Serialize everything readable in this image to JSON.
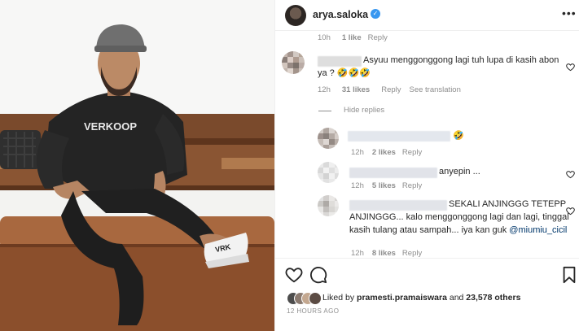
{
  "post": {
    "username": "arya.saloka",
    "verified_icon": "verified-badge-icon",
    "more_icon": "more-options-icon",
    "shirt_text": "VERKOOP",
    "sandal_text": "VRK"
  },
  "comments": [
    {
      "id": "c0",
      "age": "10h",
      "likes": "1 like",
      "reply": "Reply"
    },
    {
      "id": "c1",
      "text": "Asyuu menggonggong lagi tuh lupa di kasih abon ya ? 🤣🤣🤣",
      "age": "12h",
      "likes": "31 likes",
      "reply": "Reply",
      "translation": "See translation",
      "hide_replies": "Hide replies"
    }
  ],
  "replies": [
    {
      "id": "r1",
      "text": "🤣",
      "age": "12h",
      "likes": "2 likes",
      "reply": "Reply"
    },
    {
      "id": "r2",
      "text": "anyepin ...",
      "age": "12h",
      "likes": "5 likes",
      "reply": "Reply"
    },
    {
      "id": "r3",
      "line1": "SEKALI ANJINGGG TETEPP",
      "line2": "ANJINGGG... kalo menggonggong lagi dan lagi, tinggal",
      "line3_pre": "kasih tulang atau sampah... iya kan guk ",
      "mention": "@miumiu_cicil",
      "age": "12h",
      "likes": "8 likes",
      "reply": "Reply"
    }
  ],
  "actions": {
    "like_icon": "heart-icon",
    "comment_icon": "comment-icon",
    "save_icon": "bookmark-icon"
  },
  "likes_summary": {
    "prefix": "Liked by ",
    "user": "pramesti.pramaiswara",
    "middle": " and ",
    "others": "23,578 others"
  },
  "timestamp": "12 HOURS AGO",
  "colors": {
    "accent": "#3897f0",
    "mention": "#00376b",
    "meta": "#8e8e8e"
  }
}
